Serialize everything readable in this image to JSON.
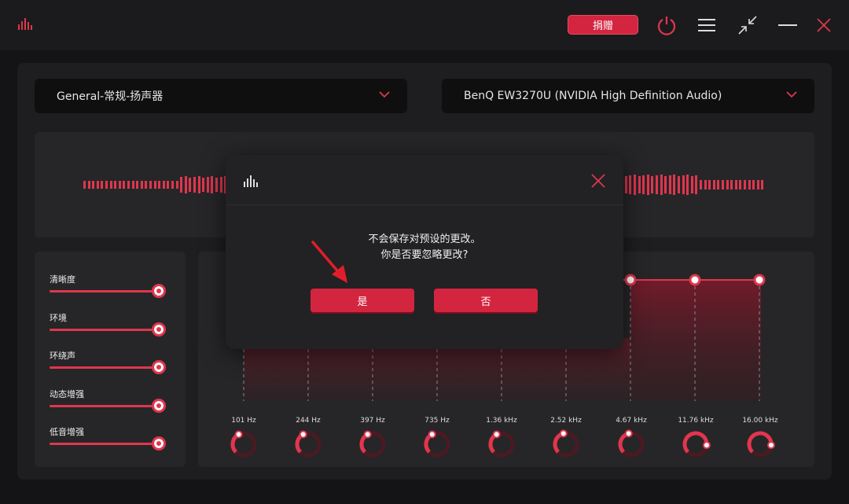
{
  "header": {
    "donate_label": "捐赠"
  },
  "selectors": {
    "preset": "General-常规-扬声器",
    "device": "BenQ EW3270U (NVIDIA High Definition Audio)"
  },
  "effects": [
    {
      "label": "清晰度",
      "value": 1.0
    },
    {
      "label": "环境",
      "value": 1.0
    },
    {
      "label": "环绕声",
      "value": 1.0
    },
    {
      "label": "动态增强",
      "value": 1.0
    },
    {
      "label": "低音增强",
      "value": 1.0
    }
  ],
  "equalizer": {
    "bands": [
      "101 Hz",
      "244 Hz",
      "397 Hz",
      "735 Hz",
      "1.36 kHz",
      "2.52 kHz",
      "4.67 kHz",
      "11.76 kHz",
      "16.00 kHz"
    ]
  },
  "dialog": {
    "line1": "不会保存对预设的更改。",
    "line2": "你是否要忽略更改?",
    "yes_label": "是",
    "no_label": "否"
  },
  "colors": {
    "accent": "#d3253f",
    "background": "#141416",
    "panel": "#262628"
  }
}
